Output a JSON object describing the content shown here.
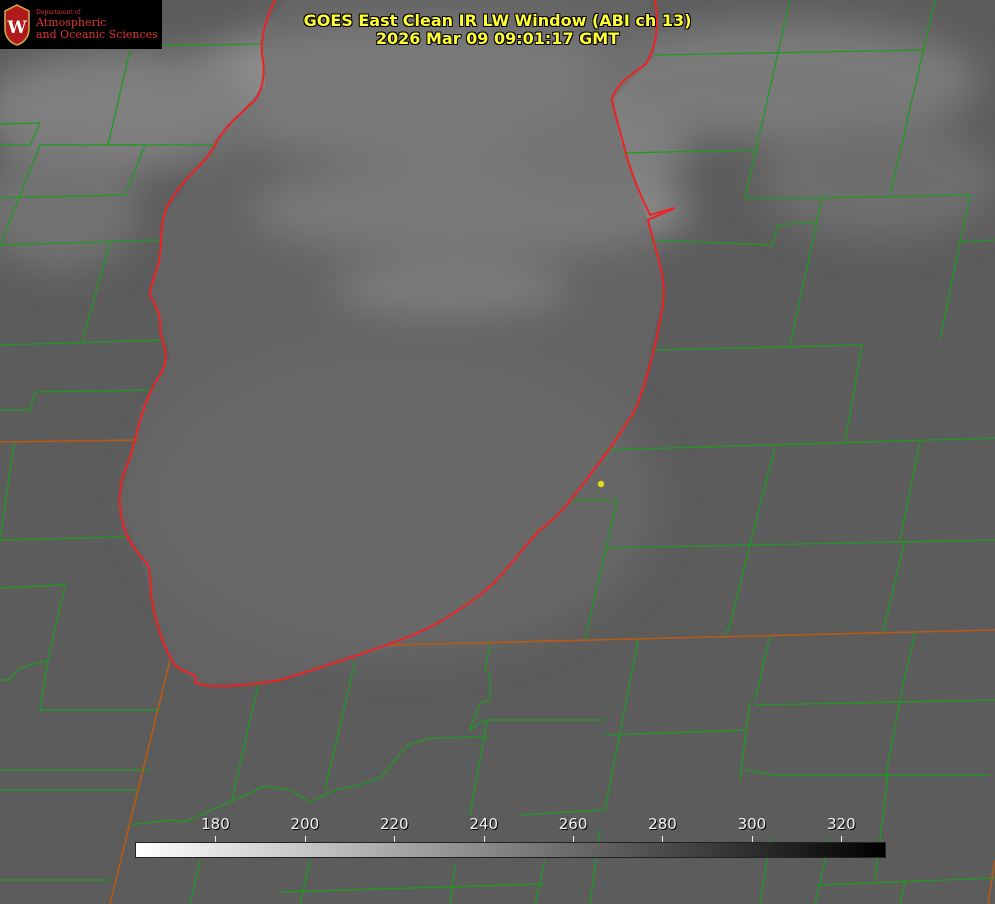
{
  "title": {
    "line1": "GOES East Clean IR LW Window (ABI ch 13)",
    "line2": "2026 Mar 09 09:01:17 GMT"
  },
  "logo": {
    "department": "Department of",
    "line1": "Atmospheric",
    "line2": "and Oceanic Sciences",
    "seal_letter": "W"
  },
  "colorbar": {
    "ticks": [
      "180",
      "200",
      "220",
      "240",
      "260",
      "280",
      "300",
      "320"
    ],
    "values": [
      180,
      200,
      220,
      240,
      260,
      280,
      300,
      320
    ],
    "range": [
      162,
      330
    ],
    "gradient": [
      "#ffffff",
      "#000000"
    ]
  },
  "colors": {
    "county_lines": "#1f9a1f",
    "shoreline": "#ee2222",
    "state_lines": "#b85a14",
    "marker": "#e8d81a",
    "title_text": "#ffff33",
    "logo_text": "#dd3333"
  },
  "icons": [
    "university-seal-icon",
    "location-marker-icon"
  ]
}
